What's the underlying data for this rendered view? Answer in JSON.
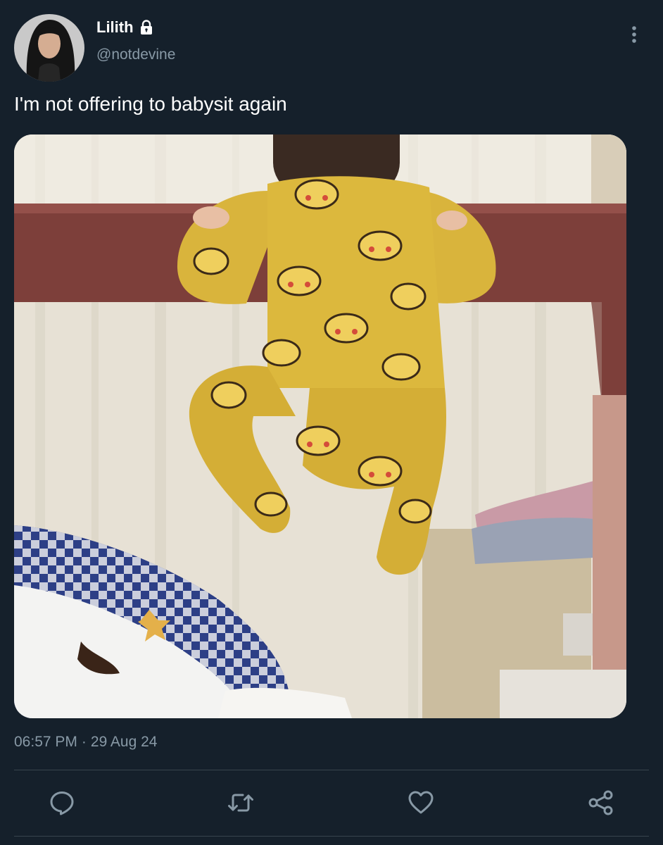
{
  "tweet": {
    "author": {
      "display_name": "Lilith",
      "handle": "@notdevine",
      "verified_icon": "lock-icon"
    },
    "text": "I'm not offering to babysit again",
    "timestamp": {
      "time": "06:57 PM",
      "separator": "·",
      "date": "29 Aug 24"
    },
    "media": {
      "alt": "Photo"
    }
  },
  "actions": [
    {
      "name": "reply",
      "icon": "reply-icon"
    },
    {
      "name": "retweet",
      "icon": "retweet-icon"
    },
    {
      "name": "like",
      "icon": "heart-icon"
    },
    {
      "name": "share",
      "icon": "share-icon"
    }
  ],
  "colors": {
    "background": "#15202b",
    "secondary_text": "#8899a6",
    "divider": "#38444d",
    "icon": "#8899a6"
  }
}
